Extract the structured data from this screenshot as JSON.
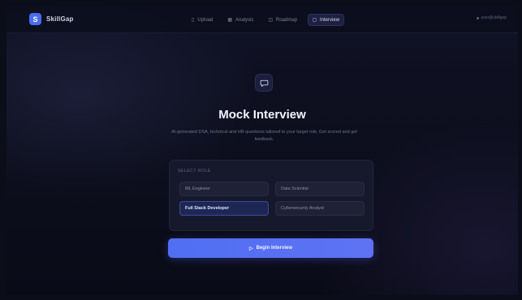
{
  "brand": {
    "logo": "S",
    "name": "SkillGap"
  },
  "nav": {
    "items": [
      {
        "icon": "upload-icon",
        "glyph": "▯",
        "label": "Upload"
      },
      {
        "icon": "analysis-icon",
        "glyph": "▦",
        "label": "Analysis"
      },
      {
        "icon": "roadmap-icon",
        "glyph": "◫",
        "label": "Roadmap"
      },
      {
        "icon": "chat-icon",
        "glyph": "◻",
        "label": "Interview"
      }
    ],
    "active_index": 3,
    "user_label": "user@skillgap"
  },
  "hero": {
    "icon": "chat-bubble-icon",
    "title": "Mock Interview",
    "subtitle": "AI-generated DSA, technical and HR questions tailored to your target role. Get scored and get feedback."
  },
  "form": {
    "label": "SELECT ROLE",
    "roles": [
      "ML Engineer",
      "Data Scientist",
      "Full Stack Developer",
      "Cybersecurity Analyst"
    ],
    "selected_index": 2
  },
  "cta": {
    "icon": "play-icon",
    "glyph": "▷",
    "label": "Begin Interview"
  },
  "colors": {
    "accent": "#4f6ff2",
    "background": "#0d0f1e",
    "card": "#16182b"
  }
}
